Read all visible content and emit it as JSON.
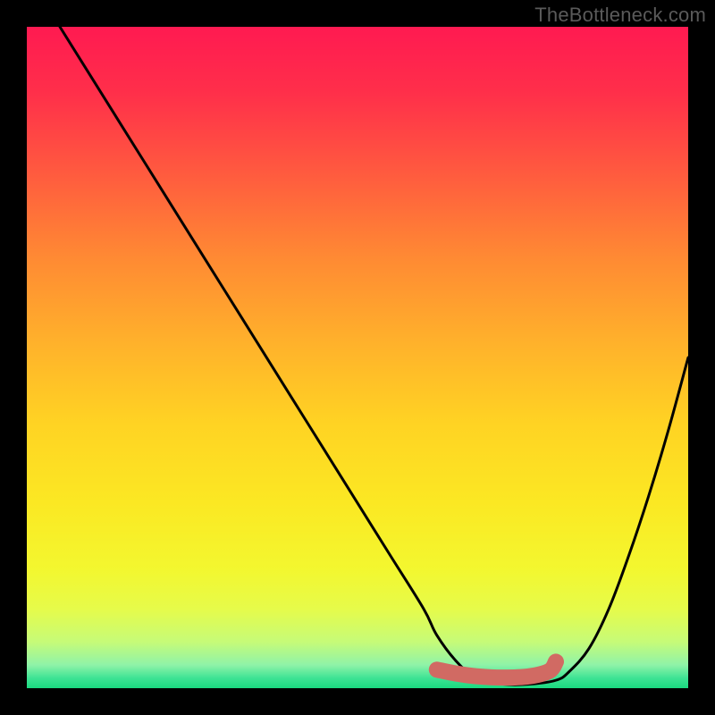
{
  "attribution": "TheBottleneck.com",
  "gradient": {
    "stops": [
      {
        "offset": 0.0,
        "color": "#ff1a51"
      },
      {
        "offset": 0.1,
        "color": "#ff2f4a"
      },
      {
        "offset": 0.22,
        "color": "#ff5a3f"
      },
      {
        "offset": 0.35,
        "color": "#ff8a33"
      },
      {
        "offset": 0.48,
        "color": "#ffb22b"
      },
      {
        "offset": 0.6,
        "color": "#ffd323"
      },
      {
        "offset": 0.72,
        "color": "#fbe823"
      },
      {
        "offset": 0.82,
        "color": "#f3f72f"
      },
      {
        "offset": 0.88,
        "color": "#e6fb4a"
      },
      {
        "offset": 0.93,
        "color": "#c6fb78"
      },
      {
        "offset": 0.965,
        "color": "#8ff3a8"
      },
      {
        "offset": 0.985,
        "color": "#3de394"
      },
      {
        "offset": 1.0,
        "color": "#1ad97f"
      }
    ]
  },
  "chart_data": {
    "type": "line",
    "title": "",
    "xlabel": "",
    "ylabel": "",
    "xlim": [
      0,
      100
    ],
    "ylim": [
      0,
      100
    ],
    "series": [
      {
        "name": "curve",
        "x": [
          5,
          10,
          15,
          20,
          25,
          30,
          35,
          40,
          45,
          50,
          55,
          60,
          62,
          65,
          68,
          72,
          76,
          80,
          82,
          85,
          88,
          91,
          94,
          97,
          100
        ],
        "y": [
          100,
          92,
          84,
          76,
          68,
          60,
          52,
          44,
          36,
          28,
          20,
          12,
          8,
          4,
          1.5,
          0.6,
          0.6,
          1.2,
          2.5,
          6,
          12,
          20,
          29,
          39,
          50
        ]
      }
    ],
    "highlight": {
      "name": "valley-marker",
      "x": [
        62,
        65,
        68,
        72,
        76,
        79,
        80
      ],
      "y": [
        2.8,
        2.2,
        1.8,
        1.6,
        1.8,
        2.6,
        4.0
      ],
      "color": "#d16a63",
      "dot": {
        "x": 62,
        "y": 2.8,
        "r": 8
      }
    }
  }
}
